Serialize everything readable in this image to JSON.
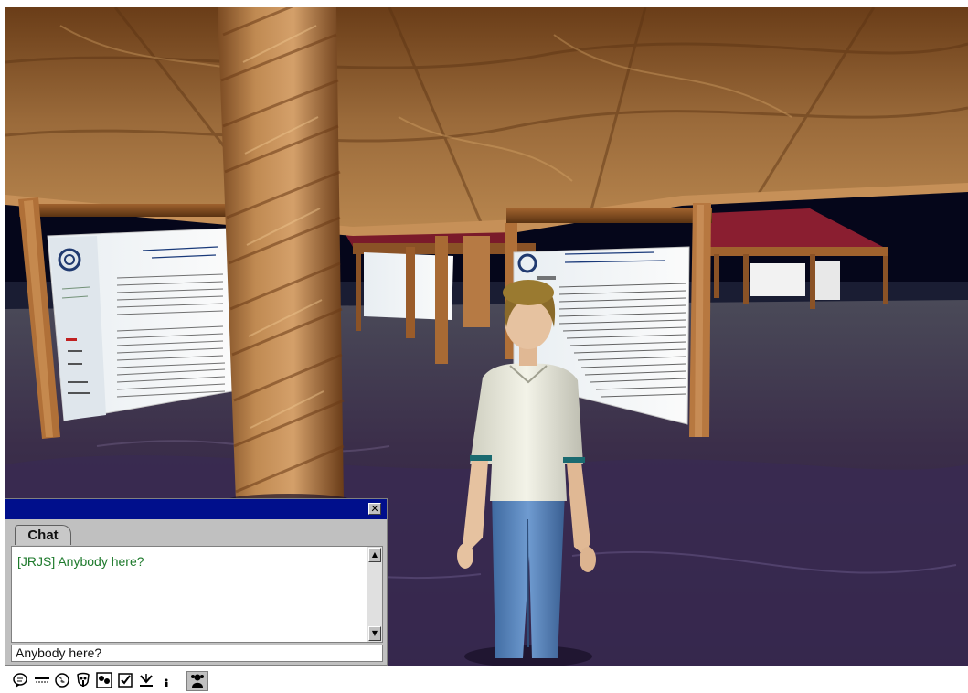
{
  "chat": {
    "tab_label": "Chat",
    "close_glyph": "✕",
    "messages": [
      {
        "speaker": "[JRJS]",
        "text": "[JRJS] Anybody here?"
      }
    ],
    "input_value": "Anybody here?",
    "scroll_up_glyph": "▲",
    "scroll_down_glyph": "▼",
    "title_bar_color": "#000f8c",
    "message_color": "#1e7a2c"
  },
  "toolbar": {
    "icons": [
      "speech-bubble-icon",
      "gesture-icon",
      "globe-icon",
      "mask-icon",
      "theater-masks-icon",
      "checkbox-icon",
      "download-icon",
      "small-figure-icon",
      "avatar-icon"
    ]
  }
}
